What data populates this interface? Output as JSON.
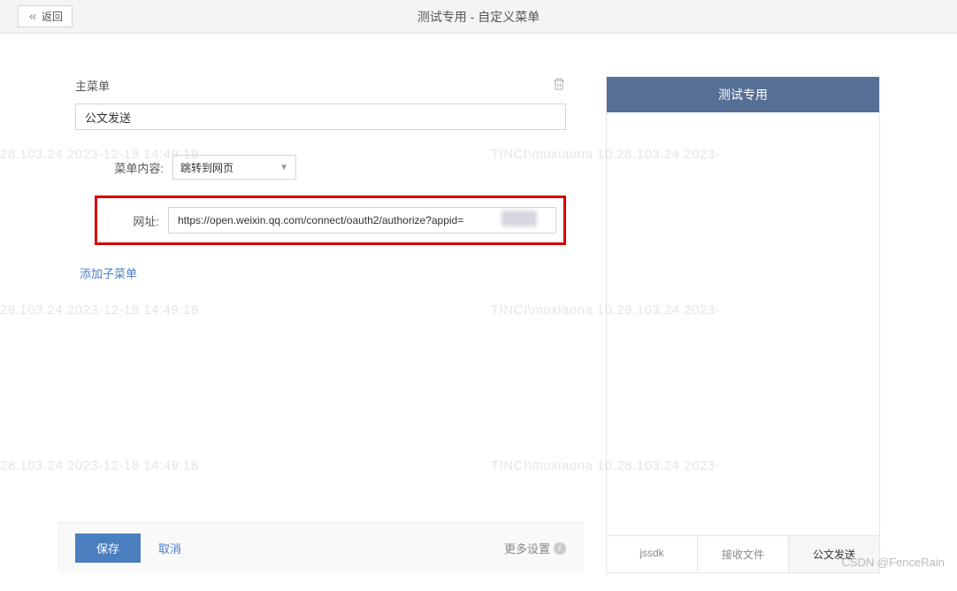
{
  "header": {
    "back_label": "返回",
    "title": "测试专用 - 自定义菜单"
  },
  "form": {
    "main_menu_label": "主菜单",
    "menu_name_value": "公文发送",
    "content_label": "菜单内容:",
    "content_select_value": "跳转到网页",
    "url_label": "网址:",
    "url_value": "https://open.weixin.qq.com/connect/oauth2/authorize?appid=",
    "add_submenu_label": "添加子菜单"
  },
  "footer": {
    "save_label": "保存",
    "cancel_label": "取消",
    "more_settings_label": "更多设置"
  },
  "preview": {
    "header_title": "测试专用",
    "tabs": [
      {
        "label": "jssdk",
        "active": false
      },
      {
        "label": "接收文件",
        "active": false
      },
      {
        "label": "公文发送",
        "active": true
      }
    ]
  },
  "watermarks": {
    "line1_left": "28.103.24  2023-12-18  14:49:18",
    "line1_right": "TINCI\\moxiaona  10.28.103.24  2023-",
    "csdn": "CSDN @FenceRain"
  }
}
